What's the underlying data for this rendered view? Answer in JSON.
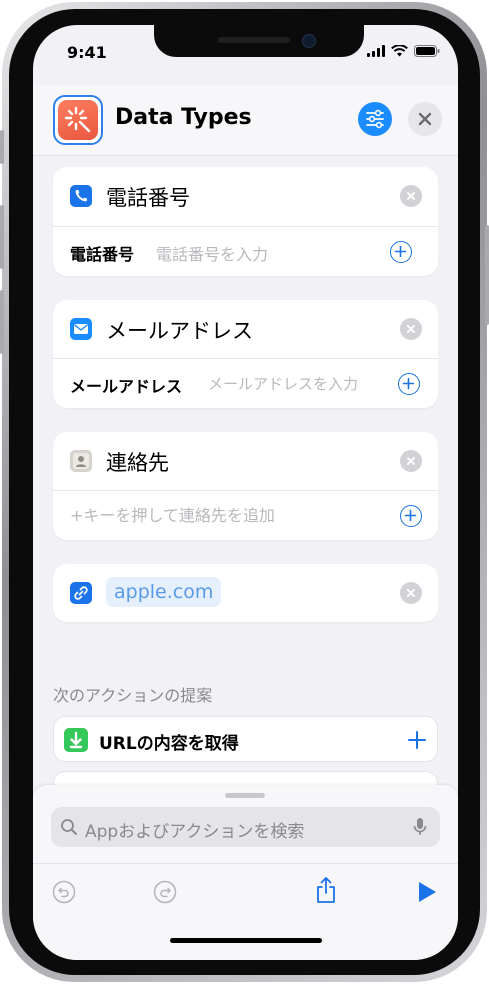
{
  "status_bar": {
    "time": "9:41"
  },
  "header": {
    "title": "Data Types"
  },
  "cards": [
    {
      "title": "電話番号",
      "field_label": "電話番号",
      "field_placeholder": "電話番号を入力"
    },
    {
      "title": "メールアドレス",
      "field_label": "メールアドレス",
      "field_placeholder": "メールアドレスを入力"
    },
    {
      "title": "連絡先",
      "field_placeholder": "+キーを押して連絡先を追加"
    },
    {
      "url": "apple.com"
    }
  ],
  "suggestions": {
    "label": "次のアクションの提案",
    "items": [
      {
        "label": "URLの内容を取得"
      }
    ]
  },
  "search": {
    "placeholder": "Appおよびアクションを検索"
  },
  "colors": {
    "accent": "#1a73e8",
    "green": "#34c759",
    "orange": "#e8573f"
  }
}
